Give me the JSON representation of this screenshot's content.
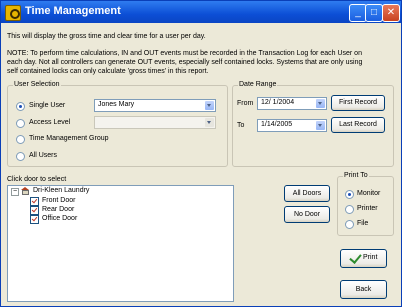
{
  "window": {
    "title": "Time Management"
  },
  "description": {
    "line1": "This will display the gross time and clear time for a user per day.",
    "line2": "NOTE: To perform time calculations, IN and OUT events must be recorded in the Transaction Log for each User on",
    "line3": "each day. Not all controllers can generate OUT events, especially self contained locks. Systems that are only using",
    "line4": "self contained locks can only calculate 'gross times' in this report."
  },
  "user_selection": {
    "label": "User Selection",
    "options": [
      {
        "label": "Single User",
        "selected": true
      },
      {
        "label": "Access Level",
        "selected": false
      },
      {
        "label": "Time Management Group",
        "selected": false
      },
      {
        "label": "All Users",
        "selected": false
      }
    ],
    "single_user_value": "Jones Mary",
    "access_level_value": ""
  },
  "date_range": {
    "label": "Date Range",
    "from_label": "From",
    "from_value": "12/ 1/2004",
    "to_label": "To",
    "to_value": "1/14/2005",
    "first_record_label": "First Record",
    "last_record_label": "Last Record"
  },
  "doors": {
    "label": "Click door to select",
    "root": "Dri-Kleen Laundry",
    "items": [
      "Front Door",
      "Rear Door",
      "Office Door"
    ],
    "all_doors_label": "All Doors",
    "no_door_label": "No Door"
  },
  "print_to": {
    "label": "Print To",
    "options": [
      {
        "label": "Monitor",
        "selected": true
      },
      {
        "label": "Printer",
        "selected": false
      },
      {
        "label": "File",
        "selected": false
      }
    ]
  },
  "actions": {
    "print_label": "Print",
    "back_label": "Back"
  },
  "icons": [
    "app-icon",
    "minimize-icon",
    "maximize-icon",
    "close-icon",
    "building-icon",
    "checkmark-icon"
  ]
}
